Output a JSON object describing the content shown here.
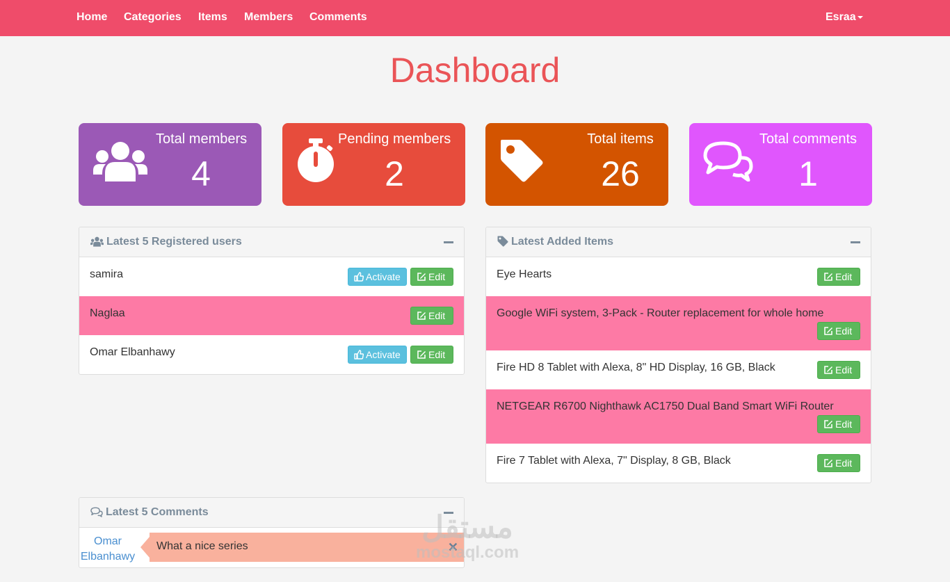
{
  "nav": {
    "links": [
      "Home",
      "Categories",
      "Items",
      "Members",
      "Comments"
    ],
    "user": "Esraa"
  },
  "page": {
    "title": "Dashboard"
  },
  "stats": [
    {
      "label": "Total members",
      "value": "4",
      "color": "#9b59b6",
      "icon": "users-icon"
    },
    {
      "label": "Pending members",
      "value": "2",
      "color": "#e74c3c",
      "icon": "stopwatch-icon"
    },
    {
      "label": "Total items",
      "value": "26",
      "color": "#d35400",
      "icon": "tag-icon"
    },
    {
      "label": "Total comments",
      "value": "1",
      "color": "#e056fd",
      "icon": "comments-icon"
    }
  ],
  "latest_users": {
    "title": "Latest 5 Registered users",
    "activate_label": "Activate",
    "edit_label": "Edit",
    "rows": [
      {
        "name": "samira",
        "pending": true
      },
      {
        "name": "Naglaa",
        "pending": false
      },
      {
        "name": "Omar Elbanhawy",
        "pending": true
      }
    ]
  },
  "latest_items": {
    "title": "Latest Added Items",
    "edit_label": "Edit",
    "rows": [
      {
        "name": "Eye Hearts"
      },
      {
        "name": "Google WiFi system, 3-Pack - Router replacement for whole home"
      },
      {
        "name": "Fire HD 8 Tablet with Alexa, 8\" HD Display, 16 GB, Black"
      },
      {
        "name": "NETGEAR R6700 Nighthawk AC1750 Dual Band Smart WiFi Router"
      },
      {
        "name": "Fire 7 Tablet with Alexa, 7\" Display, 8 GB, Black"
      }
    ]
  },
  "latest_comments": {
    "title": "Latest 5 Comments",
    "comments": [
      {
        "author": "Omar Elbanhawy",
        "text": "What a nice series"
      }
    ]
  },
  "watermark": {
    "arabic": "مستقل",
    "latin": "mostaql.com"
  },
  "colors": {
    "navbar": "#ef4c6a",
    "title": "#ea5457",
    "highlight_row": "#fd7aa5",
    "edit_button": "#5cb85c",
    "activate_button": "#5bc0de",
    "comment_bubble": "#f9b19d"
  }
}
